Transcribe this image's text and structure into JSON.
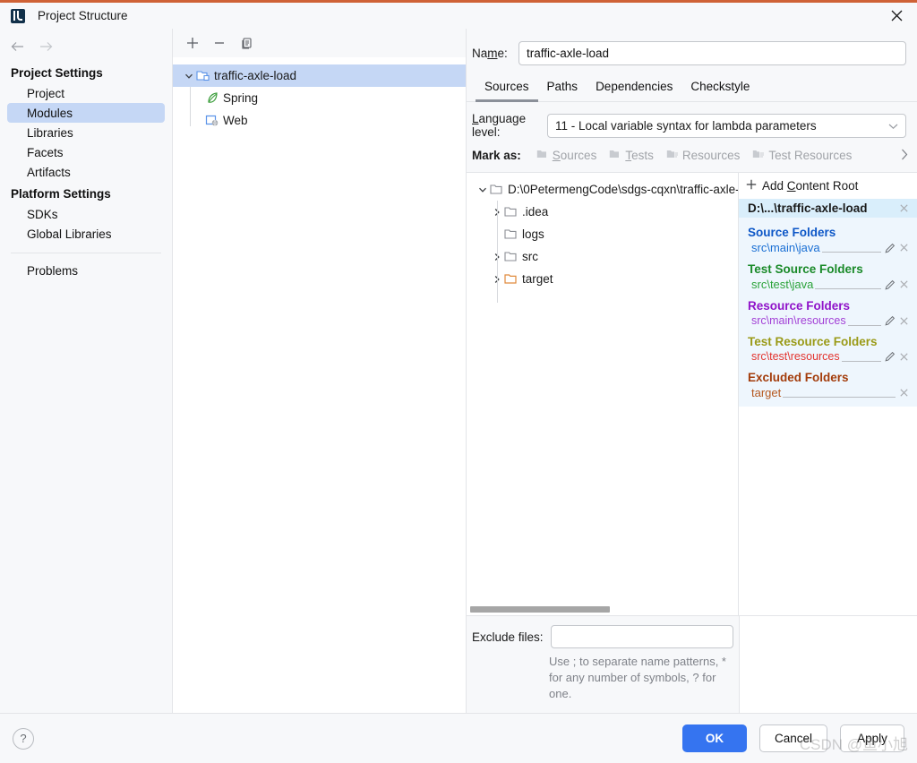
{
  "window": {
    "title": "Project Structure",
    "logo_icon": "intellij-idea-logo",
    "close_icon": "close-icon",
    "accent_color": "#cf6236"
  },
  "sidebar": {
    "back_icon": "arrow-left-icon",
    "forward_icon": "arrow-right-icon",
    "groups": [
      {
        "heading": "Project Settings",
        "items": [
          {
            "label": "Project",
            "selected": false
          },
          {
            "label": "Modules",
            "selected": true
          },
          {
            "label": "Libraries",
            "selected": false
          },
          {
            "label": "Facets",
            "selected": false
          },
          {
            "label": "Artifacts",
            "selected": false
          }
        ]
      },
      {
        "heading": "Platform Settings",
        "items": [
          {
            "label": "SDKs",
            "selected": false
          },
          {
            "label": "Global Libraries",
            "selected": false
          }
        ]
      }
    ],
    "problems": {
      "label": "Problems"
    },
    "selected_color": "#c5d7f5"
  },
  "modules_panel": {
    "toolbar": {
      "add_label": "+",
      "remove_label": "−",
      "copy_icon": "copy-icon"
    },
    "tree": [
      {
        "label": "traffic-axle-load",
        "icon": "module-folder-icon",
        "expanded": true,
        "selected": true,
        "depth": 0
      },
      {
        "label": "Spring",
        "icon": "spring-leaf-icon",
        "expanded": null,
        "selected": false,
        "depth": 1
      },
      {
        "label": "Web",
        "icon": "web-facet-icon",
        "expanded": null,
        "selected": false,
        "depth": 1
      }
    ]
  },
  "detail": {
    "name_label": "Name:",
    "name_value": "traffic-axle-load",
    "name_placeholder": "",
    "tabs": [
      {
        "label": "Sources",
        "active": true
      },
      {
        "label": "Paths",
        "active": false
      },
      {
        "label": "Dependencies",
        "active": false
      },
      {
        "label": "Checkstyle",
        "active": false
      }
    ],
    "language_level_label": "Language level:",
    "language_level_value": "11 - Local variable syntax for lambda parameters",
    "language_level_caret_icon": "chevron-down-icon",
    "mark_as_label": "Mark as:",
    "mark_as_buttons": [
      {
        "label": "Sources",
        "icon": "folder-sources-icon",
        "enabled": false
      },
      {
        "label": "Tests",
        "icon": "folder-tests-icon",
        "enabled": false
      },
      {
        "label": "Resources",
        "icon": "folder-resources-icon",
        "enabled": false
      },
      {
        "label": "Test Resources",
        "icon": "folder-test-resources-icon",
        "enabled": false
      }
    ],
    "mark_as_more_icon": "chevron-right-icon"
  },
  "fs_tree": [
    {
      "label": "D:\\0PetermengCode\\sdgs-cqxn\\traffic-axle-",
      "depth": 0,
      "twisty": "expanded",
      "icon": "folder-icon",
      "color": "#111111"
    },
    {
      "label": ".idea",
      "depth": 1,
      "twisty": "collapsed",
      "icon": "folder-icon",
      "color": "#111111"
    },
    {
      "label": "logs",
      "depth": 1,
      "twisty": "none",
      "icon": "folder-icon",
      "color": "#111111"
    },
    {
      "label": "src",
      "depth": 1,
      "twisty": "collapsed",
      "icon": "folder-icon",
      "color": "#111111"
    },
    {
      "label": "target",
      "depth": 1,
      "twisty": "collapsed",
      "icon": "folder-excluded-icon",
      "color": "#111111"
    }
  ],
  "content_roots": {
    "add_label": "Add Content Root",
    "add_icon": "plus-icon",
    "root_label": "D:\\...\\traffic-axle-load",
    "root_close_icon": "close-small-icon",
    "groups": [
      {
        "title": "Source Folders",
        "color": "#0d57c7",
        "entries": [
          {
            "path": "src\\main\\java",
            "edit_icon": "pencil-icon",
            "remove_icon": "close-small-icon"
          }
        ]
      },
      {
        "title": "Test Source Folders",
        "color": "#1a8a29",
        "entries": [
          {
            "path": "src\\test\\java",
            "edit_icon": "pencil-icon",
            "remove_icon": "close-small-icon"
          }
        ]
      },
      {
        "title": "Resource Folders",
        "color": "#9013c9",
        "entries": [
          {
            "path": "src\\main\\resources",
            "edit_icon": "pencil-icon",
            "remove_icon": "close-small-icon"
          }
        ]
      },
      {
        "title": "Test Resource Folders",
        "color": "#9a9a17",
        "entries": [
          {
            "path": "src\\test\\resources",
            "color": "#e3342f",
            "edit_icon": "pencil-icon",
            "remove_icon": "close-small-icon"
          }
        ]
      },
      {
        "title": "Excluded Folders",
        "color": "#a33c0b",
        "entries": [
          {
            "path": "target",
            "remove_icon": "close-small-icon"
          }
        ]
      }
    ]
  },
  "exclude": {
    "label": "Exclude files:",
    "value": "",
    "placeholder": "",
    "hint": "Use ; to separate name patterns, * for any number of symbols, ? for one."
  },
  "footer": {
    "help_label": "?",
    "ok_label": "OK",
    "cancel_label": "Cancel",
    "apply_label": "Apply",
    "primary_color": "#3574f0"
  },
  "watermark": {
    "text": "CSDN @鱼小旭"
  }
}
